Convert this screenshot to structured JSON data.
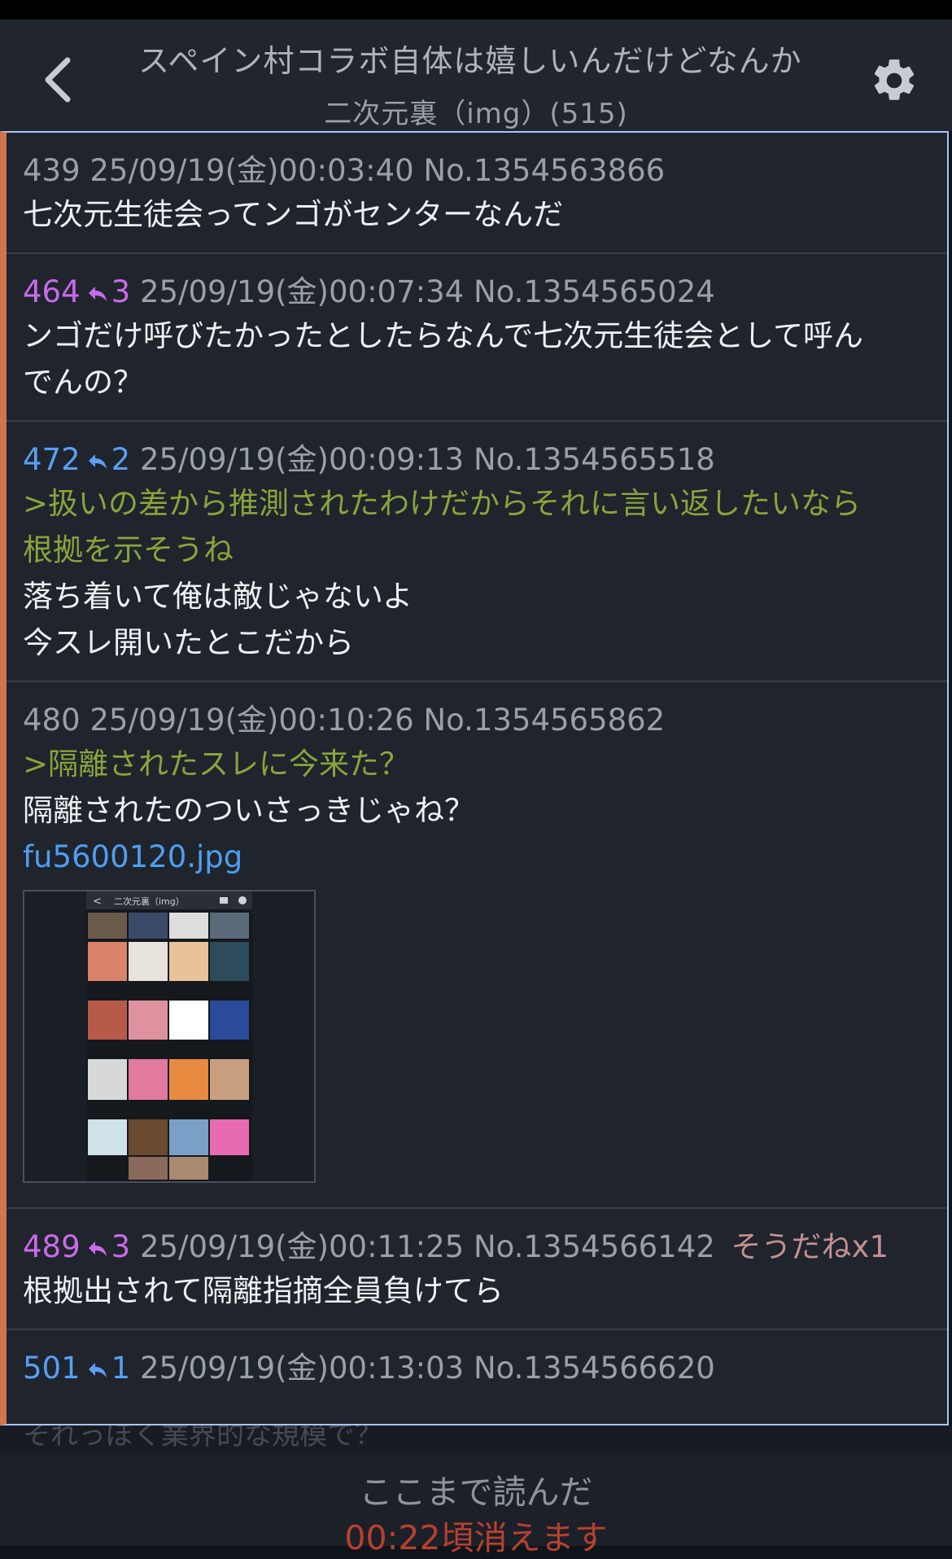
{
  "header": {
    "title": "スペイン村コラボ自体は嬉しいんだけどなんか",
    "board": "二次元裏（img）",
    "count": "(515)"
  },
  "posts": [
    {
      "num": "439",
      "num_color": "gray",
      "replies": "",
      "date": "25/09/19(金)00:03:40",
      "no": "No.1354563866",
      "sodane": "",
      "quotes": [],
      "lines": [
        "七次元生徒会ってンゴがセンターなんだ"
      ]
    },
    {
      "num": "464",
      "num_color": "purple",
      "replies": "3",
      "date": "25/09/19(金)00:07:34",
      "no": "No.1354565024",
      "sodane": "",
      "quotes": [],
      "lines": [
        "ンゴだけ呼びたかったとしたらなんで七次元生徒会として呼ん",
        "でんの？"
      ]
    },
    {
      "num": "472",
      "num_color": "blue",
      "replies": "2",
      "date": "25/09/19(金)00:09:13",
      "no": "No.1354565518",
      "sodane": "",
      "quotes": [
        ">扱いの差から推測されたわけだからそれに言い返したいなら",
        "根拠を示そうね"
      ],
      "lines": [
        "落ち着いて俺は敵じゃないよ",
        "今スレ開いたとこだから"
      ]
    },
    {
      "num": "480",
      "num_color": "gray",
      "replies": "",
      "date": "25/09/19(金)00:10:26",
      "no": "No.1354565862",
      "sodane": "",
      "quotes": [
        ">隔離されたスレに今来た？"
      ],
      "lines": [
        "隔離されたのついさっきじゃね？"
      ],
      "file": "fu5600120.jpg",
      "thumb_title": "二次元裏（img）"
    },
    {
      "num": "489",
      "num_color": "purple",
      "replies": "3",
      "date": "25/09/19(金)00:11:25",
      "no": "No.1354566142",
      "sodane": "そうだねx1",
      "quotes": [],
      "lines": [
        "根拠出されて隔離指摘全員負けてら"
      ]
    },
    {
      "num": "501",
      "num_color": "blue",
      "replies": "1",
      "date": "25/09/19(金)00:13:03",
      "no": "No.1354566620",
      "sodane": "",
      "quotes": [],
      "lines": []
    }
  ],
  "footer": {
    "dimmed_text": "それっぽく業界的な規模で？",
    "read_here": "ここまで読んだ",
    "countdown": "00:22頃消えます"
  },
  "colors": {
    "background": "#1f242d",
    "header": "#20252e",
    "purple_num": "#c96bea",
    "blue_num": "#5b9ef2",
    "quote": "#8aa43b",
    "link": "#4f9ef0",
    "sodane": "#c48f8f",
    "countdown": "#b8402f",
    "accent_left": "#d2744e",
    "frame": "#a9c4f2"
  },
  "icons": {
    "back": "chevron-left-icon",
    "settings": "gear-icon",
    "reply": "reply-arrow-icon"
  }
}
